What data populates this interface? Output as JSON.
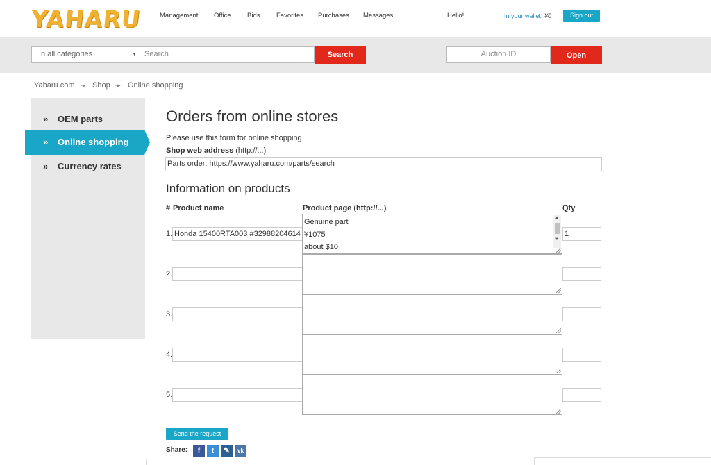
{
  "header": {
    "logo_text": "YAHARU",
    "nav": [
      "Management",
      "Office",
      "Bids",
      "Favorites",
      "Purchases",
      "Messages"
    ],
    "hello": "Hello!",
    "wallet_label": "In your wallet:",
    "wallet_amount": "¥0",
    "signout_label": "Sign out"
  },
  "search": {
    "category_value": "In all categories",
    "search_placeholder": "Search",
    "search_button": "Search",
    "auction_placeholder": "Auction ID",
    "open_button": "Open"
  },
  "breadcrumb": [
    "Yaharu.com",
    "Shop",
    "Online shopping"
  ],
  "sidebar": {
    "items": [
      {
        "label": "OEM parts"
      },
      {
        "label": "Online shopping"
      },
      {
        "label": "Currency rates"
      }
    ]
  },
  "main": {
    "title": "Orders from online stores",
    "intro": "Please use this form for online shopping",
    "shop_label_bold": "Shop web address",
    "shop_label_hint": "(http://...)",
    "shop_value": "Parts order: https://www.yaharu.com/parts/search",
    "products_title": "Information on products",
    "col_num": "#",
    "col_name": "Product name",
    "col_page": "Product page (http://...)",
    "col_qty": "Qty",
    "rows": [
      {
        "num": "1.",
        "name": "Honda 15400RTA003 #32988204614",
        "page_lines": [
          "Genuine part",
          "¥1075",
          "about $10"
        ],
        "qty": "1"
      },
      {
        "num": "2.",
        "name": "",
        "page_lines": [],
        "qty": ""
      },
      {
        "num": "3.",
        "name": "",
        "page_lines": [],
        "qty": ""
      },
      {
        "num": "4.",
        "name": "",
        "page_lines": [],
        "qty": ""
      },
      {
        "num": "5.",
        "name": "",
        "page_lines": [],
        "qty": ""
      }
    ],
    "send_button": "Send the request",
    "share_label": "Share:",
    "share_icons": [
      {
        "name": "facebook-icon",
        "glyph": "f",
        "color": "#3b5998"
      },
      {
        "name": "twitter-icon",
        "glyph": "t",
        "color": "#3b8fd6"
      },
      {
        "name": "livejournal-icon",
        "glyph": "✎",
        "color": "#2f5f8f"
      },
      {
        "name": "vk-icon",
        "glyph": "vk",
        "color": "#4a76a8"
      }
    ]
  },
  "colors": {
    "accent": "#1aa6c6",
    "button_red": "#e2271b",
    "logo": "#f0b030"
  }
}
